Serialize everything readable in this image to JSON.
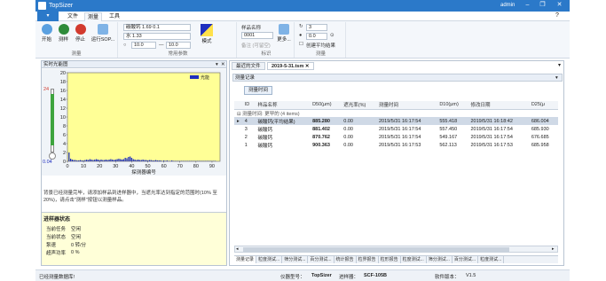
{
  "app": {
    "title": "TopSizer",
    "user": "admin"
  },
  "menu": {
    "tabs": [
      "文件",
      "测量",
      "工具"
    ],
    "active": 1
  },
  "ribbon": {
    "measure": {
      "buttons": [
        "开始",
        "测样",
        "停止",
        "运行SOP..."
      ],
      "label": "测量"
    },
    "params": {
      "sample_material": "碳酸钙 1.69 0.1",
      "medium": "水 1.33",
      "range_min": "10.0",
      "range_max": "10.0",
      "mode_label": "模式",
      "label": "常用参数"
    },
    "sample": {
      "name_label": "样品名称",
      "name_value": "0001",
      "note_placeholder": "备注 (可留空)",
      "more_label": "更多...",
      "label": "标识"
    },
    "repeat": {
      "count": "3",
      "interval": "0.0",
      "create_avg_label": "创建平均结果",
      "label": "测量"
    }
  },
  "left_panel": {
    "title": "实时光能图",
    "gauge_values": [
      "24",
      "0.04"
    ],
    "message": "背景已经测量完毕，请添加样品到进样器中，当遮光率达到指定的范围时(10% 至 20%)，请点击\"测样\"按钮以测量样品。",
    "status_title": "进样器状态",
    "status_rows": [
      {
        "label": "当前任务",
        "value": "空闲"
      },
      {
        "label": "当前状态",
        "value": "空闲"
      },
      {
        "label": "泵速",
        "value": "0 转/分"
      },
      {
        "label": "超声功率",
        "value": "0 %"
      }
    ]
  },
  "chart_data": {
    "type": "bar",
    "title": "",
    "xlabel": "探测器编号",
    "ylabel": "",
    "xlim": [
      0,
      95
    ],
    "ylim": [
      0,
      20
    ],
    "xticks": [
      0,
      10,
      20,
      30,
      40,
      50,
      60,
      70,
      80,
      90
    ],
    "yticks": [
      0,
      2,
      4,
      6,
      8,
      10,
      12,
      14,
      16,
      18,
      20
    ],
    "series": [
      {
        "name": "光能",
        "x": [
          1,
          2,
          3,
          4,
          5,
          6,
          7,
          8,
          9,
          10,
          11,
          12,
          13,
          14,
          15,
          16,
          17,
          18,
          19,
          20,
          21,
          22,
          23,
          24,
          25,
          26,
          27,
          28,
          29,
          30,
          31,
          32,
          33,
          34,
          35,
          36,
          37,
          38,
          39,
          40,
          41,
          42,
          43,
          44,
          45,
          46,
          47,
          48,
          49,
          50,
          51,
          52,
          53,
          54,
          55,
          56,
          57,
          58,
          59,
          60,
          61,
          62,
          63,
          64,
          65,
          66,
          67,
          68,
          69,
          70,
          71,
          72,
          73,
          74,
          75,
          76,
          77,
          78,
          79,
          80,
          81,
          82,
          83,
          84,
          85,
          86,
          87,
          88,
          89,
          90,
          91,
          92
        ],
        "values": [
          2.0,
          0.6,
          0.4,
          0.3,
          0.3,
          0.2,
          0.2,
          0.3,
          0.2,
          0.2,
          0.3,
          0.4,
          0.3,
          0.5,
          0.4,
          0.3,
          0.4,
          0.5,
          0.4,
          0.3,
          0.4,
          0.3,
          0.3,
          0.4,
          0.3,
          0.4,
          0.5,
          0.4,
          0.3,
          0.4,
          0.5,
          0.6,
          0.5,
          0.4,
          0.5,
          0.8,
          0.7,
          1.0,
          1.1,
          0.8,
          0.5,
          0.4,
          0.3,
          0.4,
          0.3,
          0.3,
          0.4,
          0.3,
          0.3,
          0.2,
          0.3,
          0.3,
          0.2,
          0.2,
          0.3,
          0.2,
          0.2,
          0.2,
          0.1,
          0.2,
          0.1,
          0.2,
          0.1,
          0.1,
          0.2,
          0.1,
          0.1,
          0.1,
          0.1,
          0.1,
          0.1,
          0.1,
          0.1,
          0.1,
          0.1,
          0.1,
          0.1,
          0.1,
          0.1,
          0.1,
          0.1,
          0.1,
          0.1,
          0.1,
          0.1,
          0.1,
          0.1,
          0.1,
          0.1,
          0.1,
          0.1,
          0.1
        ],
        "color": "#1f2fbf"
      }
    ],
    "legend": "top-right",
    "grid": false
  },
  "right_panel": {
    "doc_tabs": [
      "最近的文件",
      "2019-5-31.tsm"
    ],
    "active_doc": 1,
    "records_title": "测量记录",
    "group_button": "测量时间",
    "group_row": "测量时间: 更早的 (4 items)",
    "columns": [
      "ID",
      "样品名称",
      "D50(μm)",
      "遮光率(%)",
      "测量时间",
      "D10(μm)",
      "修改日期",
      "D25(μ"
    ],
    "rows": [
      [
        "4",
        "碳酸钙(平均结果)",
        "885.280",
        "0.00",
        "2019/5/31 16:17:54",
        "555.418",
        "2019/5/31 16:18:42",
        "686.004"
      ],
      [
        "3",
        "碳酸钙",
        "881.402",
        "0.00",
        "2019/5/31 16:17:54",
        "557.450",
        "2019/5/31 16:17:54",
        "685.930"
      ],
      [
        "2",
        "碳酸钙",
        "870.762",
        "0.00",
        "2019/5/31 16:17:54",
        "549.167",
        "2019/5/31 16:17:54",
        "676.685"
      ],
      [
        "1",
        "碳酸钙",
        "900.363",
        "0.00",
        "2019/5/31 16:17:53",
        "562.113",
        "2019/5/31 16:17:53",
        "685.958"
      ]
    ],
    "bottom_tabs": [
      "测量记录",
      "粒度测试...",
      "筛分测试...",
      "百分测试...",
      "统计报告",
      "粒界报告",
      "粒形报告",
      "粒度测试...",
      "筛分测试...",
      "百分测试...",
      "粒度测试..."
    ]
  },
  "statusbar": {
    "left": "已经测量数据库!",
    "middle_label": "仪器型号：",
    "middle_value": "TopSizer",
    "device_label": "进样器：",
    "device_value": "SCF-105B",
    "version_label": "软件版本：",
    "version_value": "V1.5"
  }
}
